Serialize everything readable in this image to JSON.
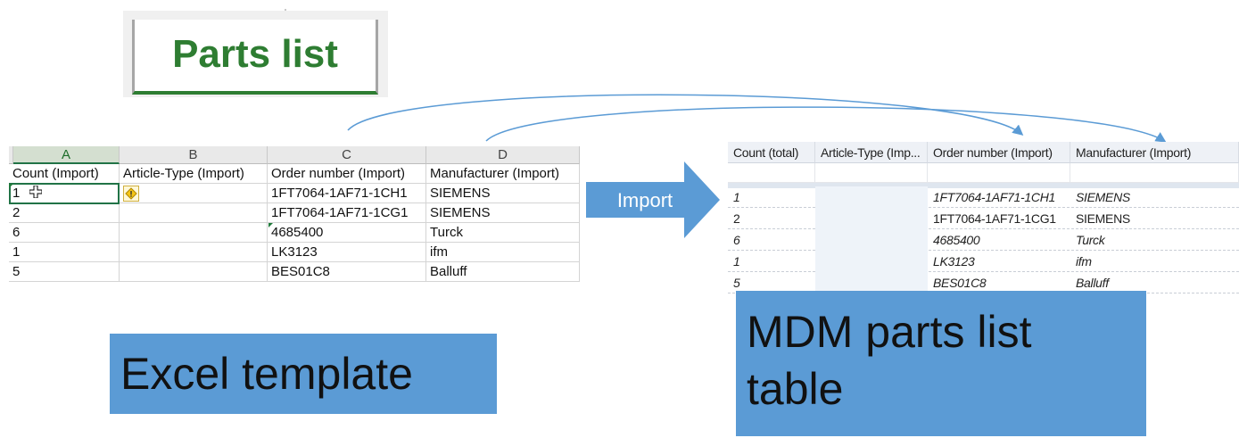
{
  "header": {
    "title": "Parts list"
  },
  "excel": {
    "columns": [
      "A",
      "B",
      "C",
      "D"
    ],
    "selected_column": "A",
    "headers": [
      "Count (Import)",
      "Article-Type (Import)",
      "Order number (Import)",
      "Manufacturer (Import)"
    ],
    "rows": [
      [
        "1",
        "",
        "1FT7064-1AF71-1CH1",
        "SIEMENS"
      ],
      [
        "2",
        "",
        "1FT7064-1AF71-1CG1",
        "SIEMENS"
      ],
      [
        "6",
        "",
        "4685400",
        "Turck"
      ],
      [
        "1",
        "",
        "LK3123",
        "ifm"
      ],
      [
        "5",
        "",
        "BES01C8",
        "Balluff"
      ]
    ]
  },
  "import_arrow": {
    "label": "Import",
    "color": "#5b9bd5"
  },
  "mdm": {
    "headers": [
      "Count (total)",
      "Article-Type (Imp...",
      "Order number (Import)",
      "Manufacturer (Import)"
    ],
    "rows": [
      [
        "1",
        "",
        "1FT7064-1AF71-1CH1",
        "SIEMENS"
      ],
      [
        "2",
        "",
        "1FT7064-1AF71-1CG1",
        "SIEMENS"
      ],
      [
        "6",
        "",
        "4685400",
        "Turck"
      ],
      [
        "1",
        "",
        "LK3123",
        "ifm"
      ],
      [
        "5",
        "",
        "BES01C8",
        "Balluff"
      ]
    ]
  },
  "captions": {
    "excel": "Excel template",
    "mdm_line1": "MDM parts list",
    "mdm_line2": "table"
  },
  "colors": {
    "accent_green": "#2e7d32",
    "excel_green": "#217346",
    "caption_blue": "#5b9bd5"
  },
  "icons": [
    "warning-icon",
    "cursor-cross-icon"
  ]
}
